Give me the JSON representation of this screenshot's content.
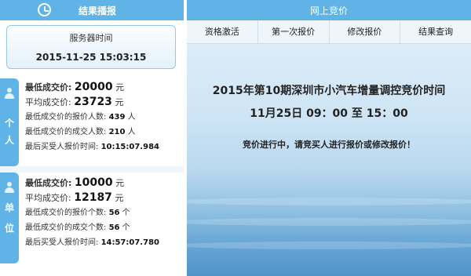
{
  "left": {
    "header": "结果播报",
    "server": {
      "title": "服务器时间",
      "time": "2015-11-25 15:03:15"
    },
    "personal": {
      "tab": [
        "个",
        "人"
      ],
      "min_price_label": "最低成交价:",
      "min_price": "20000",
      "min_price_unit": "元",
      "avg_price_label": "平均成交价:",
      "avg_price": "23723",
      "avg_price_unit": "元",
      "bidders_label": "最低成交价的报价人数:",
      "bidders": "439",
      "bidders_unit": "人",
      "winners_label": "最低成交价的成交人数:",
      "winners": "210",
      "winners_unit": "人",
      "last_time_label": "最后买受人报价时间:",
      "last_time": "10:15:07.984"
    },
    "unit": {
      "tab": [
        "单",
        "位"
      ],
      "min_price_label": "最低成交价:",
      "min_price": "10000",
      "min_price_unit": "元",
      "avg_price_label": "平均成交价:",
      "avg_price": "12187",
      "avg_price_unit": "元",
      "bidders_label": "最低成交价的报价个数:",
      "bidders": "56",
      "bidders_unit": "个",
      "winners_label": "最低成交价的成交个数:",
      "winners": "56",
      "winners_unit": "个",
      "last_time_label": "最后买受人报价时间:",
      "last_time": "14:57:07.780"
    }
  },
  "right": {
    "header": "网上竞价",
    "tabs": [
      "资格激活",
      "第一次报价",
      "修改报价",
      "结果查询"
    ],
    "headline": "2015年第10期深圳市小汽车增量调控竞价时间",
    "time_range": "11月25日 09：00 至 15：00",
    "notice": "竞价进行中，请竞买人进行报价或修改报价！"
  },
  "colors": {
    "header_blue": "#5fb3e6",
    "tab_bg": "#eef5fb"
  }
}
